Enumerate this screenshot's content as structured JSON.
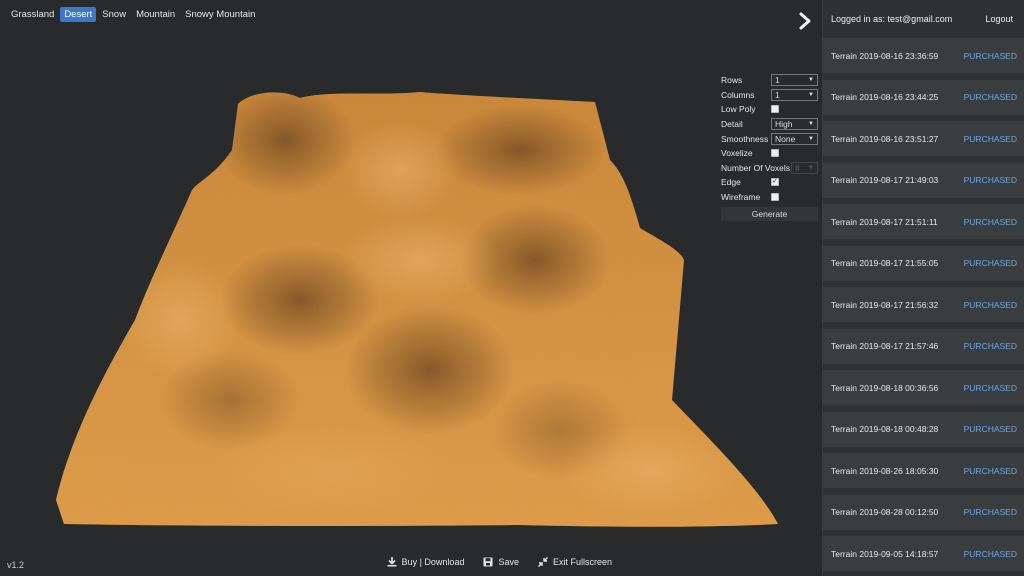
{
  "tabs": [
    {
      "label": "Grassland",
      "active": false
    },
    {
      "label": "Desert",
      "active": true
    },
    {
      "label": "Snow",
      "active": false
    },
    {
      "label": "Mountain",
      "active": false
    },
    {
      "label": "Snowy Mountain",
      "active": false
    }
  ],
  "controls": {
    "rows": {
      "label": "Rows",
      "value": "1"
    },
    "columns": {
      "label": "Columns",
      "value": "1"
    },
    "low_poly": {
      "label": "Low Poly",
      "checked": false
    },
    "detail": {
      "label": "Detail",
      "value": "High"
    },
    "smoothness": {
      "label": "Smoothness",
      "value": "None"
    },
    "voxelize": {
      "label": "Voxelize",
      "checked": false
    },
    "num_voxels": {
      "label": "Number Of Voxels",
      "value": "8"
    },
    "edge": {
      "label": "Edge",
      "checked": true
    },
    "wireframe": {
      "label": "Wireframe",
      "checked": false
    },
    "generate_label": "Generate"
  },
  "footer": {
    "version": "v1.2",
    "buy_label": "Buy | Download",
    "save_label": "Save",
    "exit_label": "Exit Fullscreen"
  },
  "sidebar": {
    "logged_in": "Logged in as: test@gmail.com",
    "logout": "Logout",
    "items": [
      {
        "name": "Terrain 2019-08-16 23:36:59",
        "status": "PURCHASED"
      },
      {
        "name": "Terrain 2019-08-16 23:44:25",
        "status": "PURCHASED"
      },
      {
        "name": "Terrain 2019-08-16 23:51:27",
        "status": "PURCHASED"
      },
      {
        "name": "Terrain 2019-08-17 21:49:03",
        "status": "PURCHASED"
      },
      {
        "name": "Terrain 2019-08-17 21:51:11",
        "status": "PURCHASED"
      },
      {
        "name": "Terrain 2019-08-17 21:55:05",
        "status": "PURCHASED"
      },
      {
        "name": "Terrain 2019-08-17 21:56:32",
        "status": "PURCHASED"
      },
      {
        "name": "Terrain 2019-08-17 21:57:46",
        "status": "PURCHASED"
      },
      {
        "name": "Terrain 2019-08-18 00:36:56",
        "status": "PURCHASED"
      },
      {
        "name": "Terrain 2019-08-18 00:48:28",
        "status": "PURCHASED"
      },
      {
        "name": "Terrain 2019-08-26 18:05:30",
        "status": "PURCHASED"
      },
      {
        "name": "Terrain 2019-08-28 00:12:50",
        "status": "PURCHASED"
      },
      {
        "name": "Terrain 2019-09-05 14:18:57",
        "status": "PURCHASED"
      }
    ]
  },
  "colors": {
    "accent": "#3a78c9",
    "purchased": "#6fa6e0",
    "sand_light": "#e8a64a",
    "sand_dark": "#5a3b18"
  }
}
